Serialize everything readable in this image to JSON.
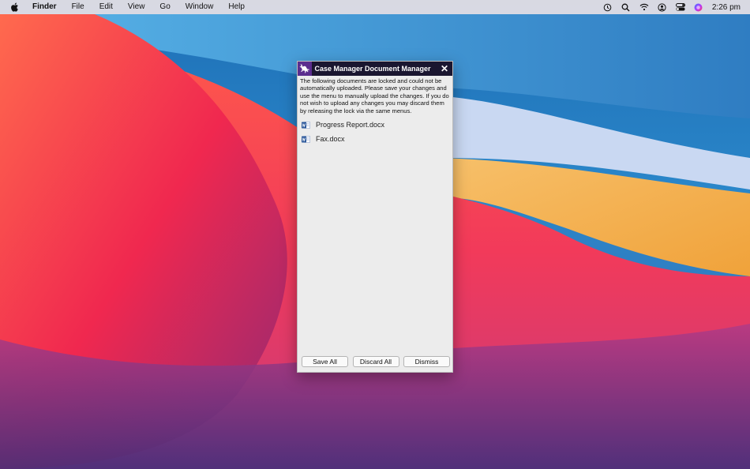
{
  "menubar": {
    "app_name": "Finder",
    "items": [
      "File",
      "Edit",
      "View",
      "Go",
      "Window",
      "Help"
    ],
    "clock": "2:26 pm",
    "status_icons": [
      "time-machine-icon",
      "search-icon",
      "wifi-icon",
      "user-icon",
      "control-center-icon",
      "siri-icon"
    ]
  },
  "dialog": {
    "title": "Case Manager Document Manager",
    "message": "The following documents are locked and could not be automatically uploaded. Please save your changes and use the menu to manually upload the changes. If you do not wish to upload any changes you may discard them by releasing the lock via the same menus.",
    "documents": [
      {
        "name": "Progress Report.docx"
      },
      {
        "name": "Fax.docx"
      }
    ],
    "buttons": {
      "save_all": "Save All",
      "discard_all": "Discard All",
      "dismiss": "Dismiss"
    },
    "close_glyph": "✕"
  },
  "colors": {
    "title_bar": "#1a1630",
    "logo_bg": "#5b2d8e",
    "dialog_bg": "#ececec"
  }
}
